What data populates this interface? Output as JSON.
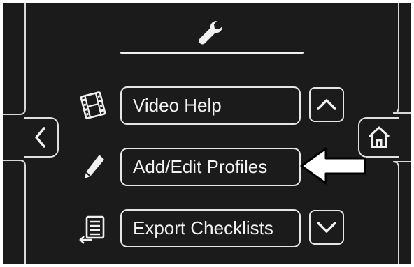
{
  "menu": {
    "items": [
      {
        "label": "Video Help",
        "icon": "film-icon"
      },
      {
        "label": "Add/Edit Profiles",
        "icon": "pencil-icon"
      },
      {
        "label": "Export Checklists",
        "icon": "export-list-icon"
      }
    ]
  },
  "header": {
    "icon": "wrench-icon"
  },
  "nav": {
    "back_icon": "chevron-left-icon",
    "home_icon": "home-icon"
  },
  "scroll": {
    "up_icon": "chevron-up-icon",
    "down_icon": "chevron-down-icon"
  },
  "annotation": {
    "icon": "pointer-arrow",
    "target": "Add/Edit Profiles"
  },
  "colors": {
    "background": "#1b1b1b",
    "foreground": "#f0f0f0",
    "outline": "#e6e6e6"
  }
}
